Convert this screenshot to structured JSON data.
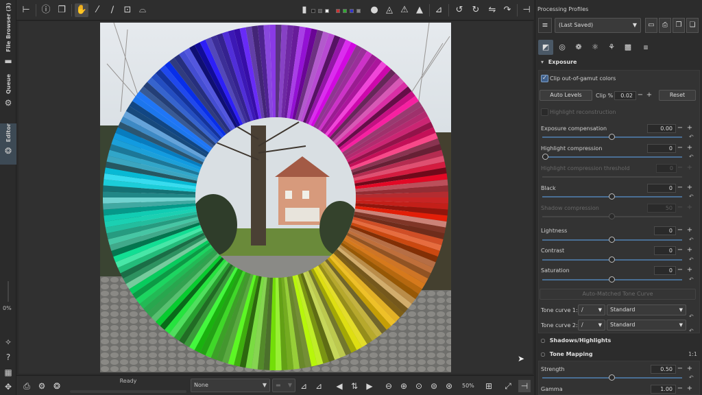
{
  "left_tabs": {
    "file_browser": "File Browser (3)",
    "queue": "Queue",
    "editor": "Editor"
  },
  "left_zoom_percent": "0%",
  "toolbar": {
    "icons": [
      "panel-toggle-icon",
      "info-icon",
      "before-after-icon",
      "hand-icon",
      "color-picker-icon",
      "wb-picker-icon",
      "crop-icon",
      "straighten-icon",
      "focus-mask-icon",
      "clipping-shadow-icon",
      "clipping-highlight-icon",
      "histogram-icon",
      "rotate-left-icon",
      "rotate-right-icon",
      "flip-horizontal-icon",
      "flip-vertical-icon",
      "preview-toggle-icon"
    ]
  },
  "status": {
    "ready_label": "Ready",
    "ready_progress": 0
  },
  "bottom": {
    "color_profile_value": "None",
    "zoom_value": "50%"
  },
  "processing_profiles": {
    "title": "Processing Profiles",
    "selected": "(Last Saved)"
  },
  "exposure": {
    "header": "Exposure",
    "clip_gamut_label": "Clip out-of-gamut colors",
    "clip_gamut_checked": true,
    "auto_levels_label": "Auto Levels",
    "clip_pct_label": "Clip %",
    "clip_pct_value": "0.02",
    "reset_label": "Reset",
    "highlight_reconstruction_label": "Highlight reconstruction",
    "exposure_comp_label": "Exposure compensation",
    "exposure_comp_value": "0.00",
    "highlight_compression_label": "Highlight compression",
    "highlight_compression_value": "0",
    "highlight_threshold_label": "Highlight compression threshold",
    "highlight_threshold_value": "0",
    "black_label": "Black",
    "black_value": "0",
    "shadow_compression_label": "Shadow compression",
    "shadow_compression_value": "50",
    "lightness_label": "Lightness",
    "lightness_value": "0",
    "contrast_label": "Contrast",
    "contrast_value": "0",
    "saturation_label": "Saturation",
    "saturation_value": "0",
    "auto_tone_curve_label": "Auto-Matched Tone Curve",
    "tone_curve_1_label": "Tone curve 1:",
    "tone_curve_1_value": "Standard",
    "tone_curve_2_label": "Tone curve 2:",
    "tone_curve_2_value": "Standard"
  },
  "shadows_highlights": {
    "header": "Shadows/Highlights"
  },
  "tone_mapping": {
    "header": "Tone Mapping",
    "badge": "1:1",
    "strength_label": "Strength",
    "strength_value": "0.50",
    "gamma_label": "Gamma",
    "gamma_value": "1.00"
  },
  "colors": {
    "accent": "#4a6f95",
    "active_tab": "#3d4a55"
  }
}
